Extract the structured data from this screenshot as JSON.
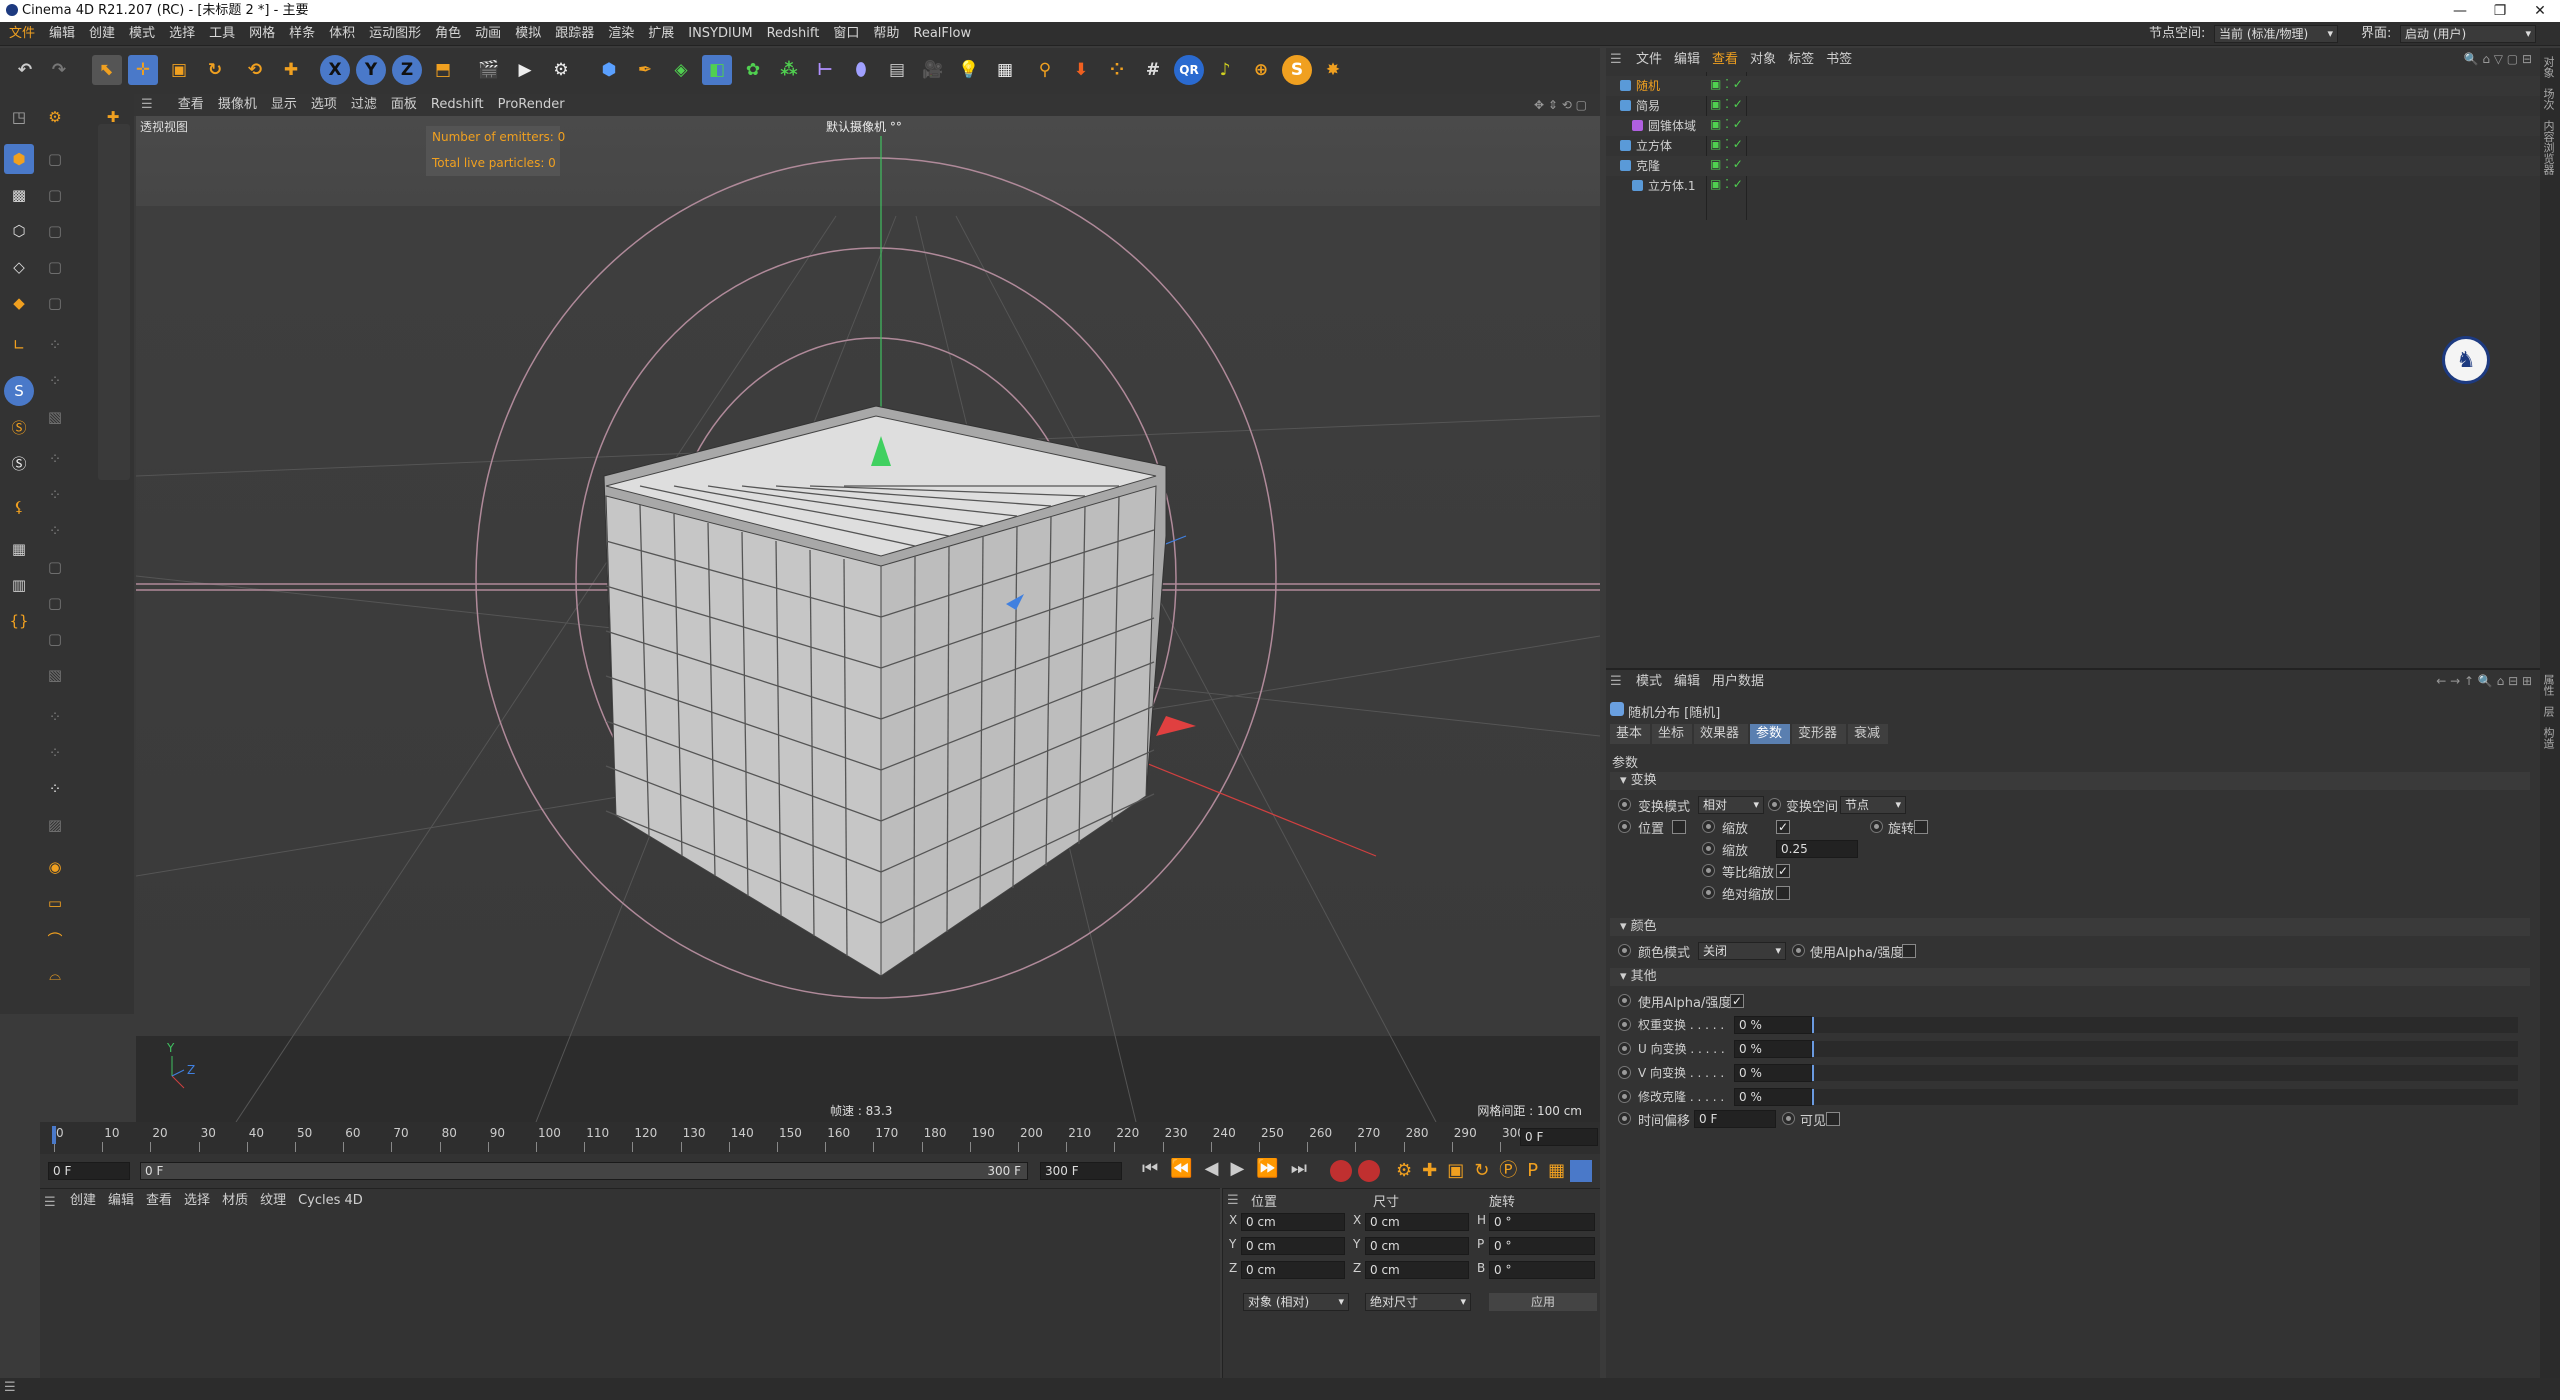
{
  "window": {
    "title": "Cinema 4D R21.207 (RC) - [未标题 2 *] - 主要",
    "minimize": "—",
    "restore": "❐",
    "close": "✕"
  },
  "menubar": {
    "items": [
      "文件",
      "编辑",
      "创建",
      "模式",
      "选择",
      "工具",
      "网格",
      "样条",
      "体积",
      "运动图形",
      "角色",
      "动画",
      "模拟",
      "跟踪器",
      "渲染",
      "扩展",
      "INSYDIUM",
      "Redshift",
      "窗口",
      "帮助",
      "RealFlow"
    ],
    "node_space_label": "节点空间:",
    "node_space_value": "当前 (标准/物理)",
    "layout_label": "界面:",
    "layout_value": "启动 (用户)"
  },
  "toolbar": {
    "icons": [
      "undo-icon",
      "redo-icon",
      "live-select-icon",
      "move-icon",
      "scale-icon",
      "rotate-icon",
      "recent-tools-icon",
      "world-axis-icon",
      "x-axis-icon",
      "y-axis-icon",
      "z-axis-icon",
      "coordinate-system-icon",
      "render-region-icon",
      "render-view-icon",
      "render-settings-icon",
      "cube-icon",
      "pen-icon",
      "subdivision-icon",
      "extrude-icon",
      "mograph-cloner-icon",
      "array-icon",
      "symmetry-icon",
      "deformer-icon",
      "floor-icon",
      "camera-icon",
      "light-icon",
      "material-icon",
      "tag-icon",
      "physics-icon",
      "xpresso-icon",
      "grid-icon",
      "qr-icon",
      "redshift-icon",
      "target-icon",
      "s-plugin-icon",
      "explode-icon"
    ],
    "axis_labels": [
      "X",
      "Y",
      "Z"
    ]
  },
  "viewport": {
    "menu": [
      "查看",
      "摄像机",
      "显示",
      "选项",
      "过滤",
      "面板",
      "Redshift",
      "ProRender"
    ],
    "view_name": "透视视图",
    "camera_label": "默认摄像机 °°",
    "emitters": "Number of emitters: 0",
    "particles": "Total live particles: 0",
    "fps": "帧速 : 83.3",
    "grid_spacing": "网格间距 : 100 cm",
    "axis_y": "Y",
    "axis_z": "Z"
  },
  "timeline": {
    "ticks": [
      "0",
      "10",
      "20",
      "30",
      "40",
      "50",
      "60",
      "70",
      "80",
      "90",
      "100",
      "110",
      "120",
      "130",
      "140",
      "150",
      "160",
      "170",
      "180",
      "190",
      "200",
      "210",
      "220",
      "230",
      "240",
      "250",
      "260",
      "270",
      "280",
      "290",
      "300"
    ],
    "current_frame_field": "0 F",
    "start_field": "0 F",
    "range_start": "0 F",
    "range_end_label": "300 F",
    "end_field": "300 F"
  },
  "material_manager": {
    "menu": [
      "创建",
      "编辑",
      "查看",
      "选择",
      "材质",
      "纹理",
      "Cycles 4D"
    ]
  },
  "coordinates": {
    "headers": [
      "位置",
      "尺寸",
      "旋转"
    ],
    "rows": [
      {
        "axis": "X",
        "pos": "0 cm",
        "size_axis": "X",
        "size": "0 cm",
        "rot_axis": "H",
        "rot": "0 °"
      },
      {
        "axis": "Y",
        "pos": "0 cm",
        "size_axis": "Y",
        "size": "0 cm",
        "rot_axis": "P",
        "rot": "0 °"
      },
      {
        "axis": "Z",
        "pos": "0 cm",
        "size_axis": "Z",
        "size": "0 cm",
        "rot_axis": "B",
        "rot": "0 °"
      }
    ],
    "mode_select": "对象 (相对)",
    "size_select": "绝对尺寸",
    "apply": "应用"
  },
  "object_manager": {
    "menu": [
      "文件",
      "编辑",
      "查看",
      "对象",
      "标签",
      "书签"
    ],
    "objects": [
      {
        "name": "随机",
        "indent": 0,
        "color": "#f0a020"
      },
      {
        "name": "简易",
        "indent": 0,
        "color": "#d0d0d0"
      },
      {
        "name": "圆锥体域",
        "indent": 1,
        "color": "#d0d0d0"
      },
      {
        "name": "立方体",
        "indent": 0,
        "color": "#d0d0d0"
      },
      {
        "name": "克隆",
        "indent": 0,
        "color": "#d0d0d0"
      },
      {
        "name": "立方体.1",
        "indent": 1,
        "color": "#d0d0d0"
      }
    ],
    "right_strip": [
      "对象",
      "场次",
      "内容浏览器"
    ]
  },
  "attribute_manager": {
    "menu": [
      "模式",
      "编辑",
      "用户数据"
    ],
    "object_title": "随机分布 [随机]",
    "tabs": [
      "基本",
      "坐标",
      "效果器",
      "参数",
      "变形器",
      "衰减"
    ],
    "active_tab": "参数",
    "section_params": "参数",
    "transform": {
      "header": "变换",
      "mode_label": "变换模式",
      "mode_value": "相对",
      "space_label": "变换空间",
      "space_value": "节点",
      "position": "位置",
      "scale": "缩放",
      "rotation": "旋转",
      "scale_label": "缩放",
      "scale_value": "0.25",
      "uniform_scale": "等比缩放",
      "absolute_scale": "绝对缩放"
    },
    "color": {
      "header": "颜色",
      "mode_label": "颜色模式",
      "mode_value": "关闭",
      "use_alpha": "使用Alpha/强度"
    },
    "other": {
      "header": "其他",
      "use_alpha": "使用Alpha/强度",
      "rows": [
        {
          "label": "权重变换 . . . . .",
          "value": "0 %"
        },
        {
          "label": "U 向变换 . . . . .",
          "value": "0 %"
        },
        {
          "label": "V 向变换 . . . . .",
          "value": "0 %"
        },
        {
          "label": "修改克隆 . . . . .",
          "value": "0 %"
        }
      ],
      "time_offset_label": "时间偏移",
      "time_offset_value": "0 F",
      "visible": "可见"
    },
    "right_strip": [
      "属性",
      "层",
      "构造"
    ]
  },
  "colors": {
    "accent": "#f0a020",
    "selected_tab": "#5a7fb0",
    "active_blue": "#4a79c9"
  }
}
